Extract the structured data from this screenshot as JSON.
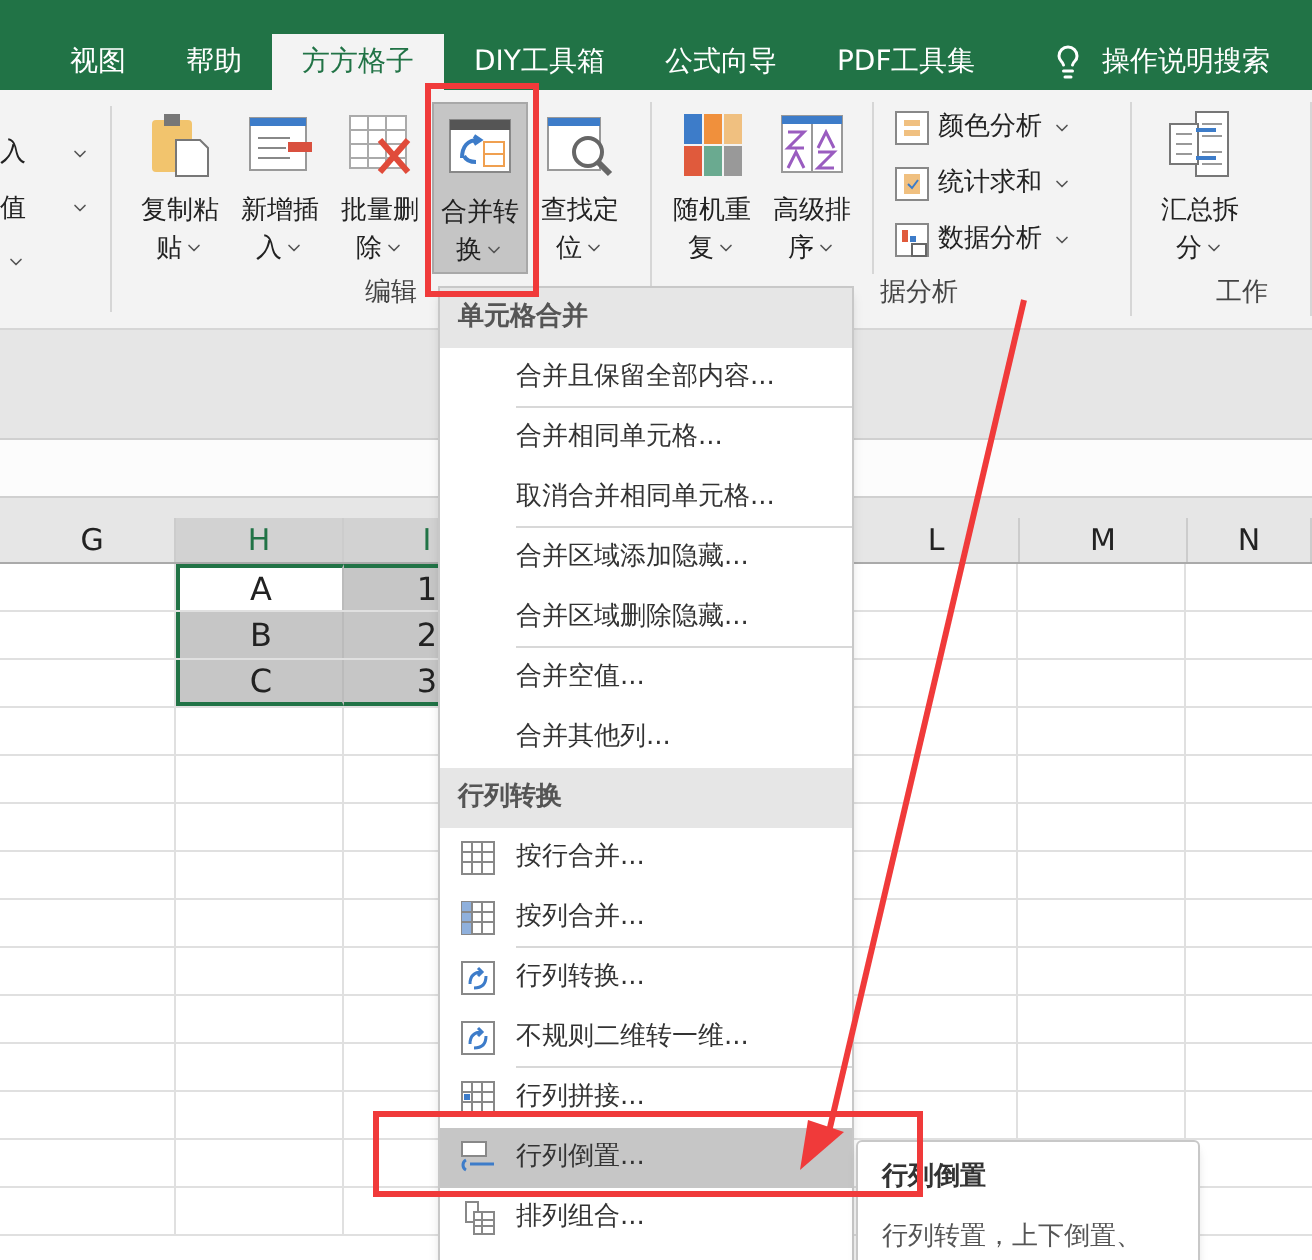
{
  "tabs": [
    {
      "label": "视图",
      "selected": false
    },
    {
      "label": "帮助",
      "selected": false
    },
    {
      "label": "方方格子",
      "selected": true
    },
    {
      "label": "DIY工具箱",
      "selected": false
    },
    {
      "label": "公式向导",
      "selected": false
    },
    {
      "label": "PDF工具集",
      "selected": false
    }
  ],
  "search": {
    "label": "操作说明搜索"
  },
  "ribbon": {
    "partial_group": {
      "items": [
        "入",
        "值"
      ]
    },
    "groups": [
      {
        "label": "编辑",
        "buttons": [
          {
            "label": "复制粘贴",
            "pressed": false
          },
          {
            "label": "新增插入",
            "pressed": false
          },
          {
            "label": "批量删除",
            "pressed": false
          },
          {
            "label": "合并转换",
            "pressed": true
          },
          {
            "label": "查找定位",
            "pressed": false
          }
        ]
      },
      {
        "label": "据分析",
        "buttons": [
          {
            "label": "随机重复",
            "pressed": false
          },
          {
            "label": "高级排序",
            "pressed": false
          }
        ],
        "small_buttons": [
          "颜色分析",
          "统计求和",
          "数据分析"
        ]
      },
      {
        "label": "工作",
        "buttons": [
          {
            "label": "汇总拆分",
            "pressed": false
          }
        ]
      }
    ]
  },
  "sheet": {
    "columns": [
      {
        "label": "G",
        "selected": false
      },
      {
        "label": "H",
        "selected": true
      },
      {
        "label": "I",
        "selected": true
      },
      {
        "label": "L",
        "selected": false
      },
      {
        "label": "M",
        "selected": false
      },
      {
        "label": "N",
        "selected": false
      }
    ],
    "rows": [
      {
        "cells": [
          {
            "text": "",
            "selected": false
          },
          {
            "text": "A",
            "selected": false
          },
          {
            "text": "1",
            "selected": true
          }
        ]
      },
      {
        "cells": [
          {
            "text": "",
            "selected": false
          },
          {
            "text": "B",
            "selected": true
          },
          {
            "text": "2",
            "selected": true
          }
        ]
      },
      {
        "cells": [
          {
            "text": "",
            "selected": false
          },
          {
            "text": "C",
            "selected": true
          },
          {
            "text": "3",
            "selected": true
          }
        ]
      }
    ]
  },
  "menu": {
    "items": [
      {
        "kind": "header",
        "label": "单元格合并"
      },
      {
        "kind": "item",
        "label": "合并且保留全部内容...",
        "selected": false,
        "separator": true
      },
      {
        "kind": "item",
        "label": "合并相同单元格...",
        "selected": false,
        "separator": false
      },
      {
        "kind": "item",
        "label": "取消合并相同单元格...",
        "selected": false,
        "separator": true
      },
      {
        "kind": "item",
        "label": "合并区域添加隐藏...",
        "selected": false,
        "separator": false
      },
      {
        "kind": "item",
        "label": "合并区域删除隐藏...",
        "selected": false,
        "separator": true
      },
      {
        "kind": "item",
        "label": "合并空值...",
        "selected": false,
        "separator": false
      },
      {
        "kind": "item",
        "label": "合并其他列...",
        "selected": false,
        "separator": false
      },
      {
        "kind": "header",
        "label": "行列转换"
      },
      {
        "kind": "icon_item",
        "label": "按行合并...",
        "selected": false,
        "separator": false
      },
      {
        "kind": "icon_item",
        "label": "按列合并...",
        "selected": false,
        "separator": true
      },
      {
        "kind": "icon_item",
        "label": "行列转换...",
        "selected": false,
        "separator": false
      },
      {
        "kind": "icon_item",
        "label": "不规则二维转一维...",
        "selected": false,
        "separator": true
      },
      {
        "kind": "icon_item",
        "label": "行列拼接...",
        "selected": false,
        "separator": false
      },
      {
        "kind": "icon_item",
        "label": "行列倒置...",
        "selected": true,
        "separator": false
      },
      {
        "kind": "icon_item",
        "label": "排列组合...",
        "selected": false,
        "separator": false
      }
    ]
  },
  "tooltip": {
    "title": "行列倒置",
    "text": "行列转置，上下倒置、"
  }
}
